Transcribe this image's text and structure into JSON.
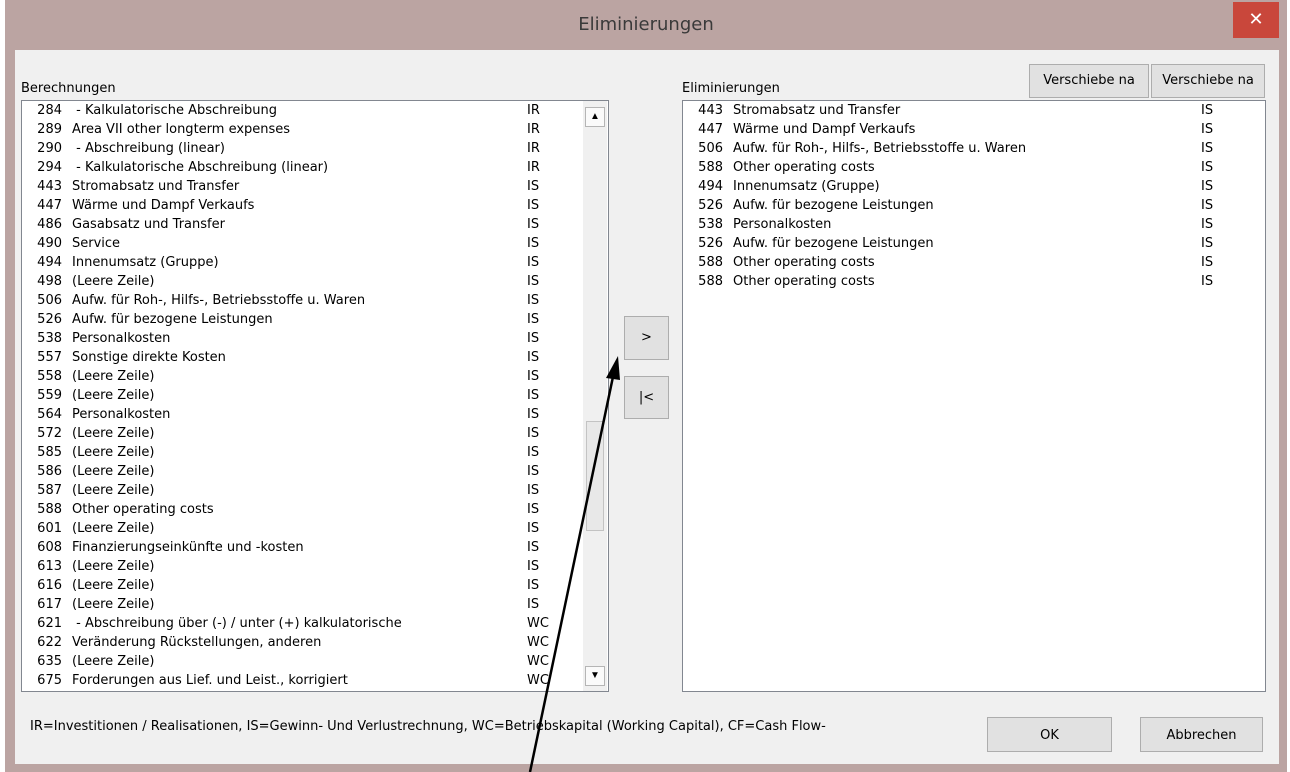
{
  "window": {
    "title": "Eliminierungen",
    "close_glyph": "✕"
  },
  "left": {
    "label": "Berechnungen",
    "items": [
      {
        "num": "284",
        "desc": " - Kalkulatorische Abschreibung",
        "type": "IR"
      },
      {
        "num": "289",
        "desc": "Area VII other longterm expenses",
        "type": "IR"
      },
      {
        "num": "290",
        "desc": " - Abschreibung (linear)",
        "type": "IR"
      },
      {
        "num": "294",
        "desc": " - Kalkulatorische Abschreibung (linear)",
        "type": "IR"
      },
      {
        "num": "443",
        "desc": "Stromabsatz und Transfer",
        "type": "IS"
      },
      {
        "num": "447",
        "desc": "Wärme und Dampf Verkaufs",
        "type": "IS"
      },
      {
        "num": "486",
        "desc": "Gasabsatz und Transfer",
        "type": "IS"
      },
      {
        "num": "490",
        "desc": "Service",
        "type": "IS"
      },
      {
        "num": "494",
        "desc": "Innenumsatz (Gruppe)",
        "type": "IS"
      },
      {
        "num": "498",
        "desc": "(Leere Zeile)",
        "type": "IS"
      },
      {
        "num": "506",
        "desc": "Aufw. für Roh-, Hilfs-, Betriebsstoffe u. Waren",
        "type": "IS"
      },
      {
        "num": "526",
        "desc": "Aufw. für bezogene Leistungen",
        "type": "IS"
      },
      {
        "num": "538",
        "desc": "Personalkosten",
        "type": "IS"
      },
      {
        "num": "557",
        "desc": "Sonstige direkte Kosten",
        "type": "IS"
      },
      {
        "num": "558",
        "desc": "(Leere Zeile)",
        "type": "IS"
      },
      {
        "num": "559",
        "desc": "(Leere Zeile)",
        "type": "IS"
      },
      {
        "num": "564",
        "desc": "Personalkosten",
        "type": "IS"
      },
      {
        "num": "572",
        "desc": "(Leere Zeile)",
        "type": "IS"
      },
      {
        "num": "585",
        "desc": "(Leere Zeile)",
        "type": "IS"
      },
      {
        "num": "586",
        "desc": "(Leere Zeile)",
        "type": "IS"
      },
      {
        "num": "587",
        "desc": "(Leere Zeile)",
        "type": "IS"
      },
      {
        "num": "588",
        "desc": "Other operating costs",
        "type": "IS"
      },
      {
        "num": "601",
        "desc": "(Leere Zeile)",
        "type": "IS"
      },
      {
        "num": "608",
        "desc": "Finanzierungseinkünfte und -kosten",
        "type": "IS"
      },
      {
        "num": "613",
        "desc": "(Leere Zeile)",
        "type": "IS"
      },
      {
        "num": "616",
        "desc": "(Leere Zeile)",
        "type": "IS"
      },
      {
        "num": "617",
        "desc": "(Leere Zeile)",
        "type": "IS"
      },
      {
        "num": "621",
        "desc": " - Abschreibung über (-) / unter (+) kalkulatorische",
        "type": "WC"
      },
      {
        "num": "622",
        "desc": "Veränderung Rückstellungen, anderen",
        "type": "WC"
      },
      {
        "num": "635",
        "desc": "(Leere Zeile)",
        "type": "WC"
      },
      {
        "num": "675",
        "desc": "Forderungen aus Lief. und Leist., korrigiert",
        "type": "WC"
      }
    ],
    "scroll_up_glyph": "▲",
    "scroll_down_glyph": "▼"
  },
  "middle": {
    "add_label": ">",
    "remove_label": "|<"
  },
  "right": {
    "label": "Eliminierungen",
    "move_button_1": "Verschiebe na",
    "move_button_2": "Verschiebe na",
    "items": [
      {
        "num": "443",
        "desc": "Stromabsatz und Transfer",
        "type": "IS"
      },
      {
        "num": "447",
        "desc": "Wärme und Dampf Verkaufs",
        "type": "IS"
      },
      {
        "num": "506",
        "desc": "Aufw. für Roh-, Hilfs-, Betriebsstoffe u. Waren",
        "type": "IS"
      },
      {
        "num": "588",
        "desc": "Other operating costs",
        "type": "IS"
      },
      {
        "num": "494",
        "desc": "Innenumsatz (Gruppe)",
        "type": "IS"
      },
      {
        "num": "526",
        "desc": "Aufw. für bezogene Leistungen",
        "type": "IS"
      },
      {
        "num": "538",
        "desc": "Personalkosten",
        "type": "IS"
      },
      {
        "num": "526",
        "desc": "Aufw. für bezogene Leistungen",
        "type": "IS"
      },
      {
        "num": "588",
        "desc": "Other operating costs",
        "type": "IS"
      },
      {
        "num": "588",
        "desc": "Other operating costs",
        "type": "IS"
      }
    ]
  },
  "footer": {
    "legend": "IR=Investitionen / Realisationen, IS=Gewinn- Und Verlustrechnung, WC=Betriebskapital (Working Capital), CF=Cash Flow-",
    "ok_label": "OK",
    "cancel_label": "Abbrechen"
  }
}
